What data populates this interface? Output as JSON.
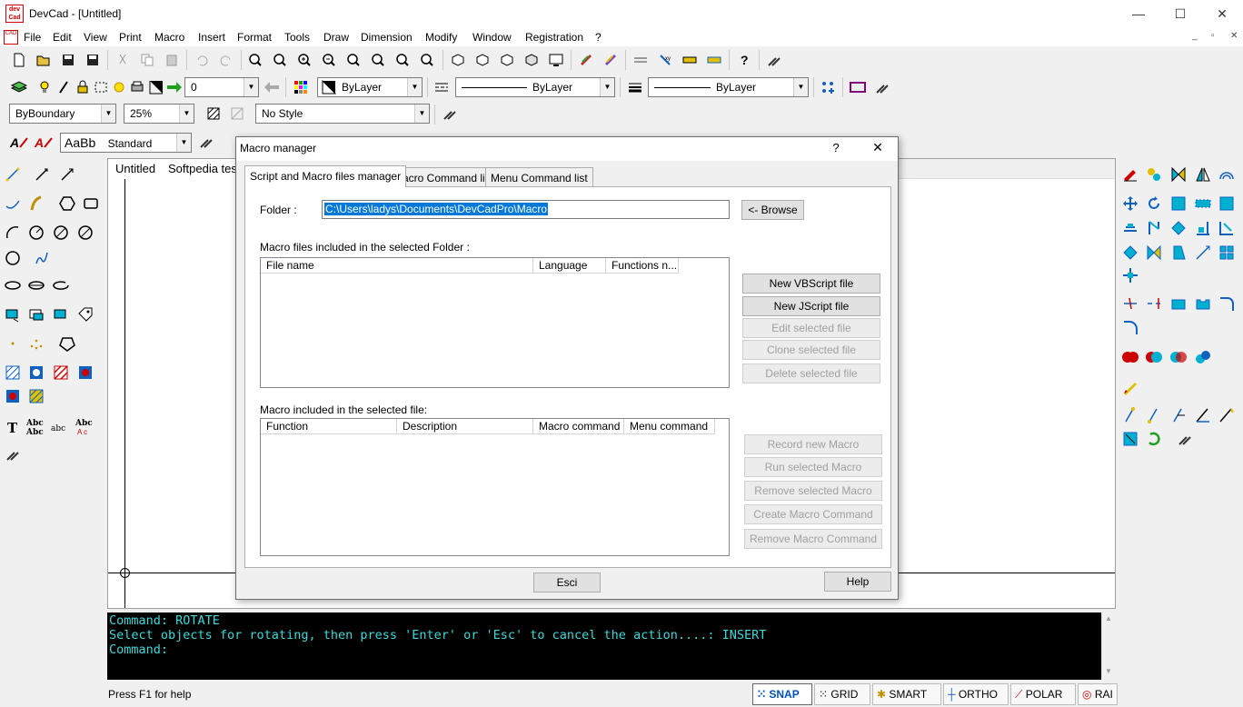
{
  "window": {
    "title": "DevCad - [Untitled]",
    "icon_text": "dev\nCad",
    "minimize": "—",
    "maximize": "☐",
    "close": "✕"
  },
  "menubar": {
    "items": [
      "File",
      "Edit",
      "View",
      "Print",
      "Macro",
      "Insert",
      "Format",
      "Tools",
      "Draw",
      "Dimension",
      "Modify",
      "Window",
      "Registration",
      "?"
    ],
    "mdi_controls": [
      "_",
      "▫",
      "✕"
    ]
  },
  "toolbar2": {
    "layer_value": "0",
    "color_value": "ByLayer",
    "linetype_value": "ByLayer",
    "lineweight_value": "ByLayer"
  },
  "toolbar3": {
    "hatch_value": "ByBoundary",
    "zoom_value": "25%",
    "style_value": "No Style"
  },
  "toolbar4": {
    "text_sample": "AaBb",
    "text_style": "Standard"
  },
  "document": {
    "tabs": [
      "Untitled",
      "Softpedia tes"
    ]
  },
  "command": {
    "lines": [
      "Command: ROTATE",
      "Select objects for rotating, then press 'Enter' or 'Esc' to cancel the action....: INSERT",
      "Command:"
    ]
  },
  "status": {
    "help": "Press F1 for help",
    "buttons": [
      "SNAP",
      "GRID",
      "SMART",
      "ORTHO",
      "POLAR",
      "RAI"
    ]
  },
  "dialog": {
    "title": "Macro manager",
    "help_btn": "?",
    "close_btn": "✕",
    "tabs": [
      "Script and Macro files manager",
      "Macro Command list",
      "Menu Command list"
    ],
    "folder_label": "Folder :",
    "folder_value": "C:\\Users\\ladys\\Documents\\DevCadPro\\Macro",
    "browse": "<- Browse",
    "files_label": "Macro files included in the selected Folder :",
    "files_columns": [
      "File name",
      "Language",
      "Functions n..."
    ],
    "file_buttons": [
      "New VBScript file",
      "New JScript file",
      "Edit selected file",
      "Clone selected file",
      "Delete selected file"
    ],
    "macros_label": "Macro included in the selected file:",
    "macros_columns": [
      "Function",
      "Description",
      "Macro command",
      "Menu command"
    ],
    "macro_buttons": [
      "Record new Macro",
      "Run selected Macro",
      "Remove selected Macro",
      "Create Macro Command",
      "Remove Macro Command"
    ],
    "esci": "Esci",
    "help": "Help"
  },
  "colors": {
    "cmd_bg": "#000000",
    "cmd_text": "#3dd9d9",
    "selection": "#0078d7",
    "icon_blue": "#1060c0",
    "icon_cyan": "#00b0d0"
  }
}
